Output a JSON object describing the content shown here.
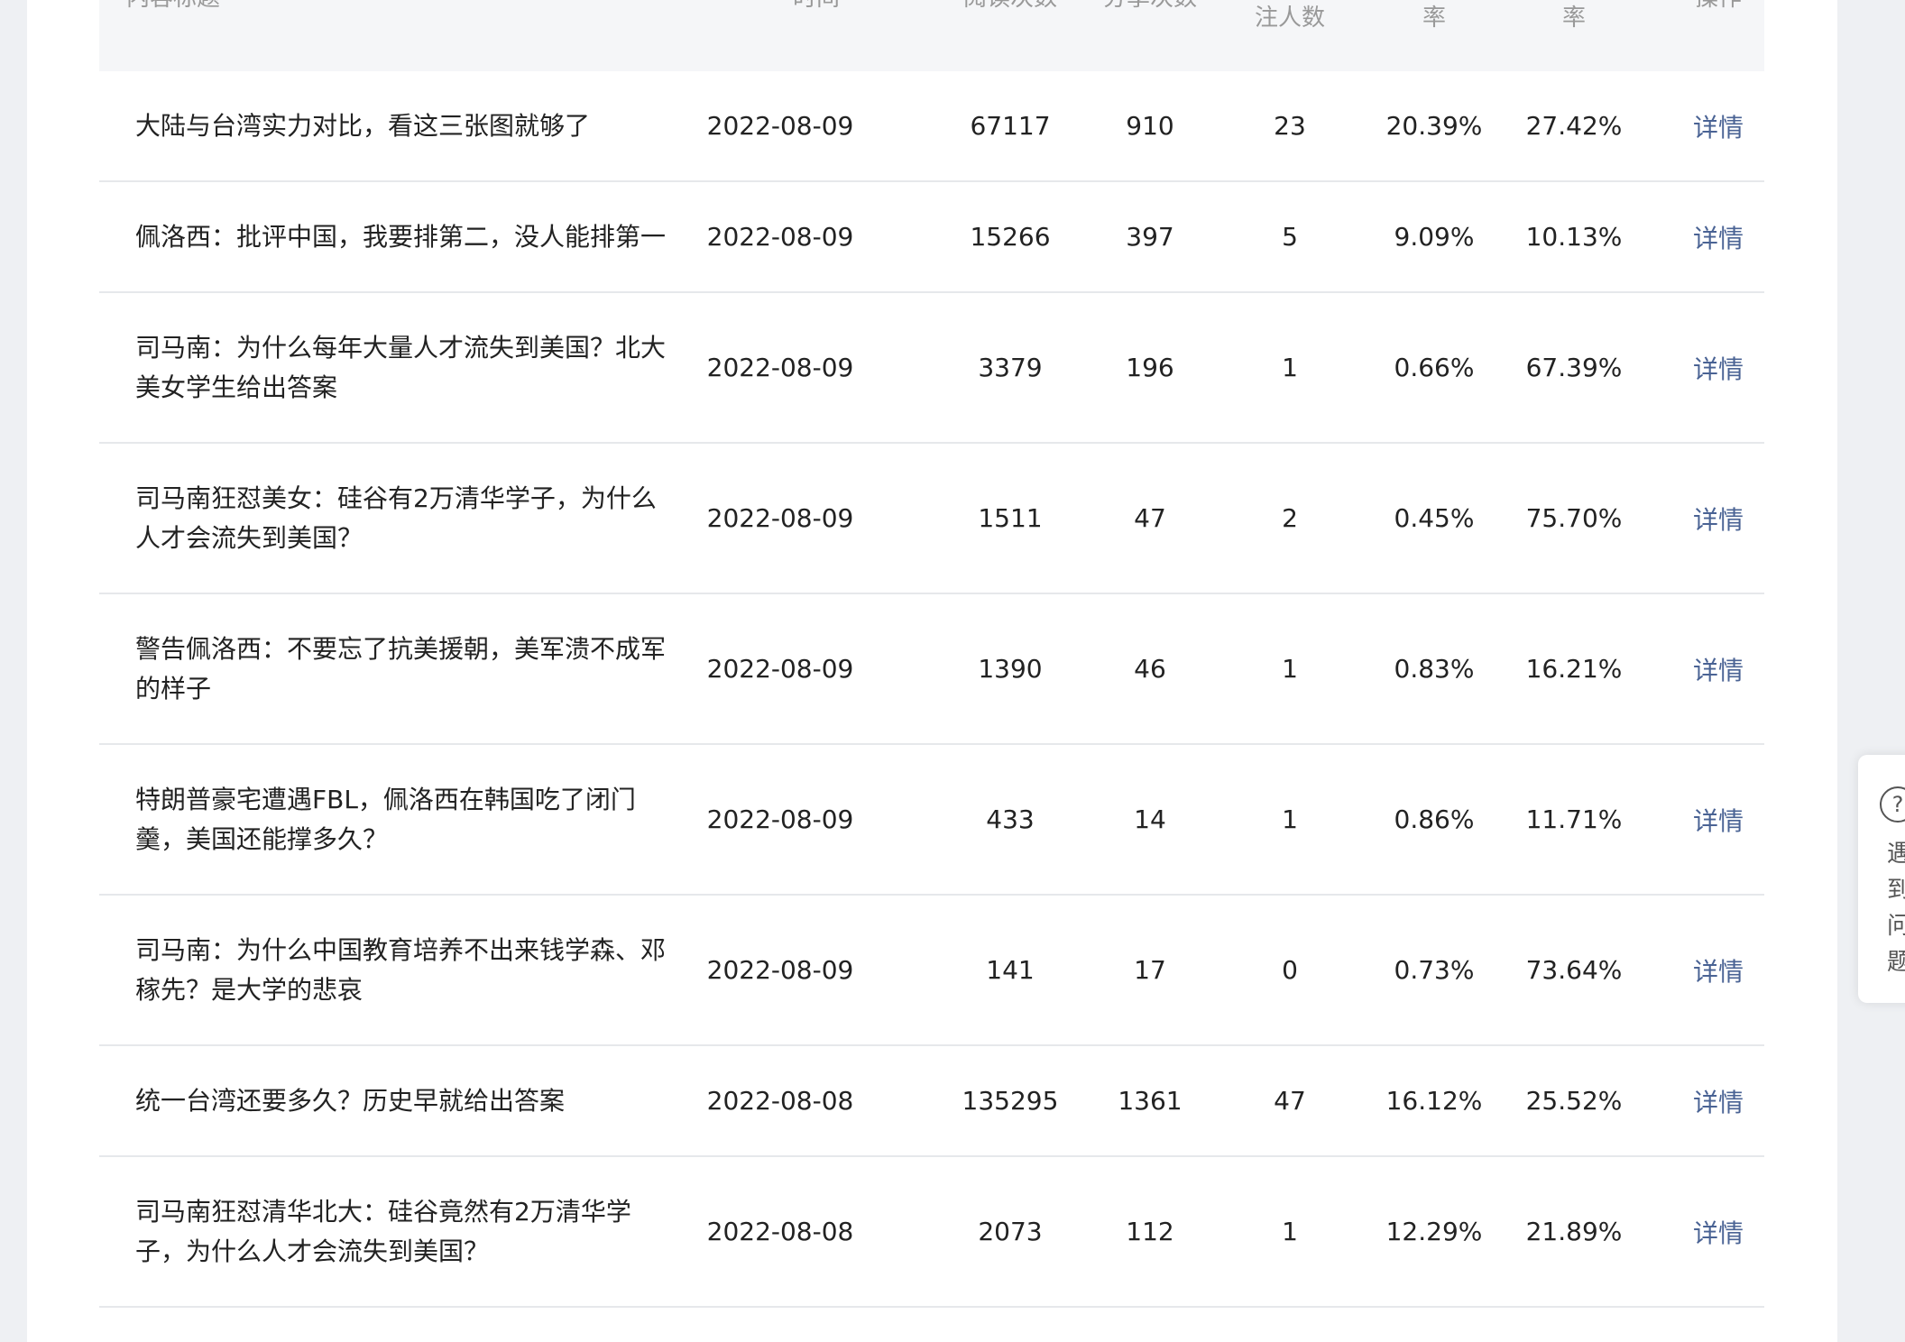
{
  "header": {
    "title_col": "内容标题",
    "date_col": "时间",
    "read_col": "阅读次数",
    "share_col": "分享次数",
    "follow_col": "注人数",
    "rate1_col": "率",
    "rate2_col": "率",
    "op_col": "操作"
  },
  "rows": [
    {
      "title": "大陆与台湾实力对比，看这三张图就够了",
      "date": "2022-08-09",
      "reads": "67117",
      "shares": "910",
      "follows": "23",
      "rate1": "20.39%",
      "rate2": "27.42%",
      "op": "详情"
    },
    {
      "title": "佩洛西：批评中国，我要排第二，没人能排第一",
      "date": "2022-08-09",
      "reads": "15266",
      "shares": "397",
      "follows": "5",
      "rate1": "9.09%",
      "rate2": "10.13%",
      "op": "详情"
    },
    {
      "title": "司马南：为什么每年大量人才流失到美国？北大美女学生给出答案",
      "date": "2022-08-09",
      "reads": "3379",
      "shares": "196",
      "follows": "1",
      "rate1": "0.66%",
      "rate2": "67.39%",
      "op": "详情"
    },
    {
      "title": "司马南狂怼美女：硅谷有2万清华学子，为什么人才会流失到美国？",
      "date": "2022-08-09",
      "reads": "1511",
      "shares": "47",
      "follows": "2",
      "rate1": "0.45%",
      "rate2": "75.70%",
      "op": "详情"
    },
    {
      "title": "警告佩洛西：不要忘了抗美援朝，美军溃不成军的样子",
      "date": "2022-08-09",
      "reads": "1390",
      "shares": "46",
      "follows": "1",
      "rate1": "0.83%",
      "rate2": "16.21%",
      "op": "详情"
    },
    {
      "title": "特朗普豪宅遭遇FBL，佩洛西在韩国吃了闭门羹，美国还能撑多久？",
      "date": "2022-08-09",
      "reads": "433",
      "shares": "14",
      "follows": "1",
      "rate1": "0.86%",
      "rate2": "11.71%",
      "op": "详情"
    },
    {
      "title": "司马南：为什么中国教育培养不出来钱学森、邓稼先？是大学的悲哀",
      "date": "2022-08-09",
      "reads": "141",
      "shares": "17",
      "follows": "0",
      "rate1": "0.73%",
      "rate2": "73.64%",
      "op": "详情"
    },
    {
      "title": "统一台湾还要多久？历史早就给出答案",
      "date": "2022-08-08",
      "reads": "135295",
      "shares": "1361",
      "follows": "47",
      "rate1": "16.12%",
      "rate2": "25.52%",
      "op": "详情"
    },
    {
      "title": "司马南狂怼清华北大：硅谷竟然有2万清华学子，为什么人才会流失到美国？",
      "date": "2022-08-08",
      "reads": "2073",
      "shares": "112",
      "follows": "1",
      "rate1": "12.29%",
      "rate2": "21.89%",
      "op": "详情"
    }
  ],
  "help": {
    "icon": "?",
    "text": "遇到问题"
  }
}
